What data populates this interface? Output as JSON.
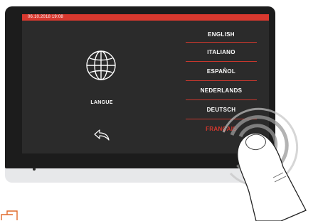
{
  "status_bar": {
    "datetime": "06.10.2018   19:08"
  },
  "left_panel": {
    "icon": "globe-icon",
    "label": "LANGUE",
    "back_icon": "back-arrow-icon"
  },
  "languages": [
    {
      "label": "ENGLISH",
      "selected": false
    },
    {
      "label": "ITALIANO",
      "selected": false
    },
    {
      "label": "ESPAÑOL",
      "selected": false
    },
    {
      "label": "NEDERLANDS",
      "selected": false
    },
    {
      "label": "DEUTSCH",
      "selected": false
    },
    {
      "label": "FRANÇAIS",
      "selected": true
    }
  ],
  "colors": {
    "accent": "#d8382e",
    "screen_bg": "#2b2b2b",
    "bezel": "#1c1c1c",
    "device_body": "#e7e8ea",
    "corner_mark": "#e06a2a"
  }
}
